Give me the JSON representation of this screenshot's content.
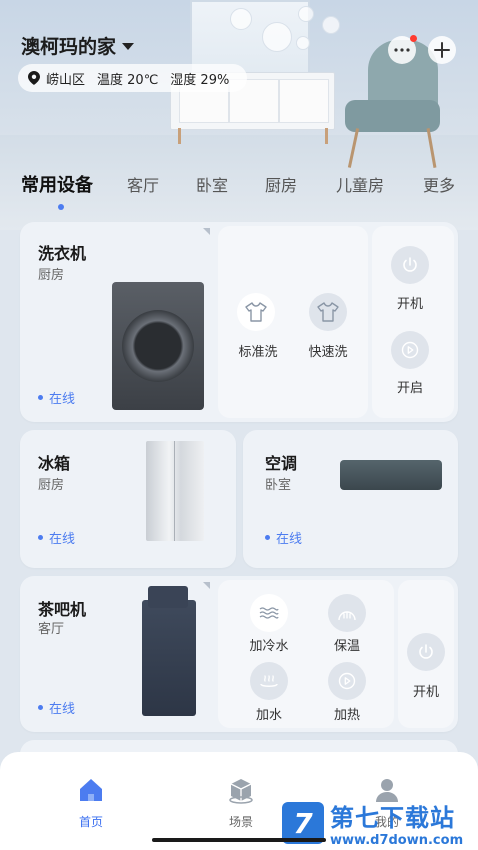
{
  "header": {
    "home_name": "澳柯玛的家",
    "district": "崂山区",
    "temperature": "温度 20℃",
    "humidity": "湿度 29%"
  },
  "tabs": [
    "常用设备",
    "客厅",
    "卧室",
    "厨房",
    "儿童房",
    "更多"
  ],
  "devices": {
    "washer": {
      "name": "洗衣机",
      "room": "厨房",
      "status": "在线",
      "actions": [
        "标准洗",
        "快速洗"
      ],
      "power_label": "开机",
      "start_label": "开启"
    },
    "fridge": {
      "name": "冰箱",
      "room": "厨房",
      "status": "在线"
    },
    "ac": {
      "name": "空调",
      "room": "卧室",
      "status": "在线"
    },
    "teabar": {
      "name": "茶吧机",
      "room": "客厅",
      "status": "在线",
      "actions": [
        "加冷水",
        "保温",
        "加水",
        "加热"
      ],
      "power_label": "开机"
    }
  },
  "bottom_nav": {
    "items": [
      "首页",
      "场景",
      "我的"
    ],
    "active_color": "#3a6ff0"
  },
  "watermark": {
    "title": "第七下载站",
    "url": "www.d7down.com"
  },
  "colors": {
    "accent": "#4c7cf0",
    "notification": "#ff3b30"
  }
}
